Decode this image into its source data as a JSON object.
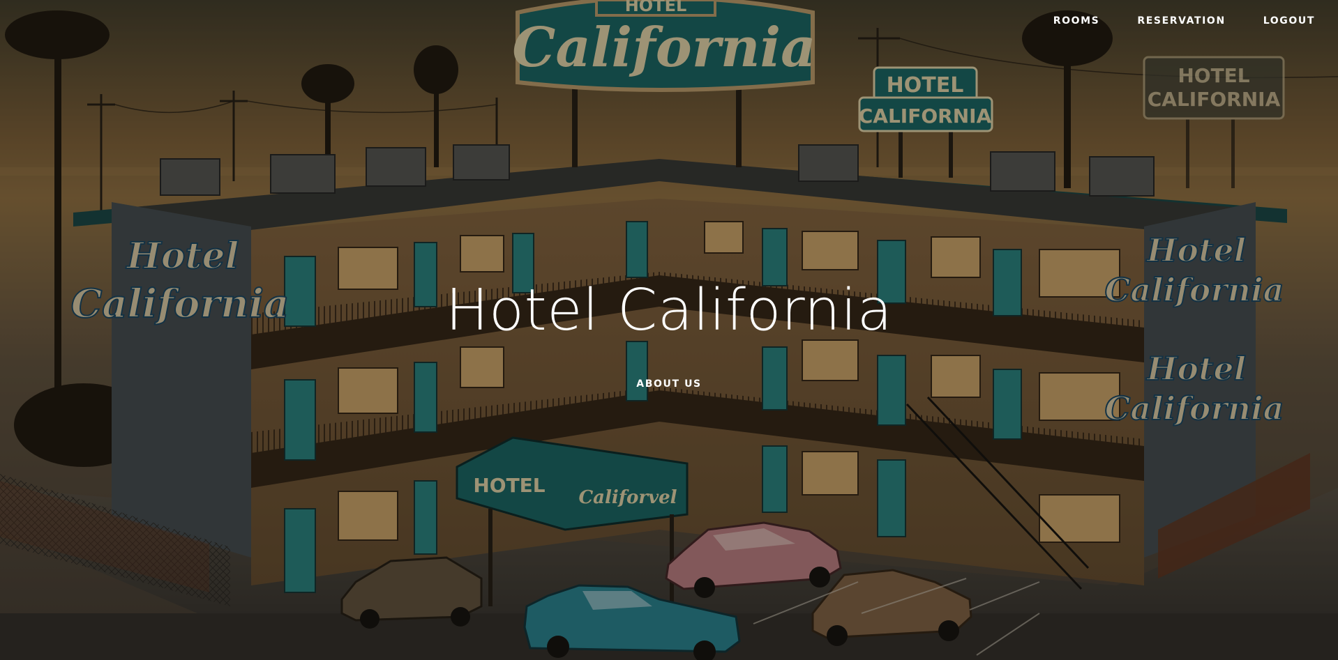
{
  "nav": {
    "items": [
      {
        "label": "ROOMS"
      },
      {
        "label": "RESERVATION"
      },
      {
        "label": "LOGOUT"
      }
    ]
  },
  "hero": {
    "title": "Hotel California",
    "link_label": "ABOUT US",
    "image_description_icon": "hotel-illustration",
    "colors": {
      "sky_top": "#5a4a32",
      "sky_glow": "#b8884a",
      "building_wall": "#8a6a42",
      "door_teal": "#2e8c88",
      "sign_teal": "#1e6e6a",
      "sign_cream": "#f2e2b4",
      "text": "#ffffff"
    }
  }
}
